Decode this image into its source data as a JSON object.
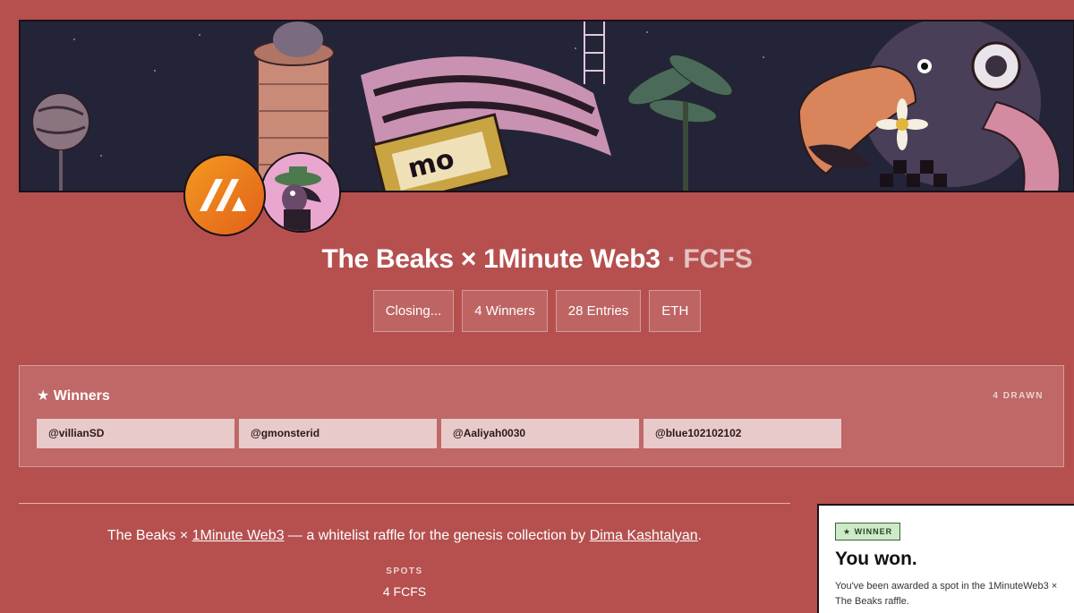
{
  "header": {
    "title": "The Beaks × 1Minute Web3",
    "subtitle": "· FCFS"
  },
  "chips": [
    "Closing...",
    "4 Winners",
    "28 Entries",
    "ETH"
  ],
  "winners": {
    "heading": "★ Winners",
    "count_label": "4 DRAWN",
    "list": [
      "@villianSD",
      "@gmonsterid",
      "@Aaliyah0030",
      "@blue102102102"
    ]
  },
  "description": {
    "prefix": "The Beaks × ",
    "link1": "1Minute Web3",
    "middle": " — a whitelist raffle for the genesis collection by ",
    "link2": "Dima Kashtalyan",
    "suffix": "."
  },
  "spots": {
    "label": "SPOTS",
    "value": "4 FCFS"
  },
  "win_card": {
    "badge": "★ WINNER",
    "title": "You won.",
    "text": "You've been awarded a spot in the 1MinuteWeb3 × The Beaks raffle."
  },
  "colors": {
    "background": "#b5504f",
    "brand_orange": "#f39a1f",
    "winner_badge": "#cfe9c9"
  }
}
